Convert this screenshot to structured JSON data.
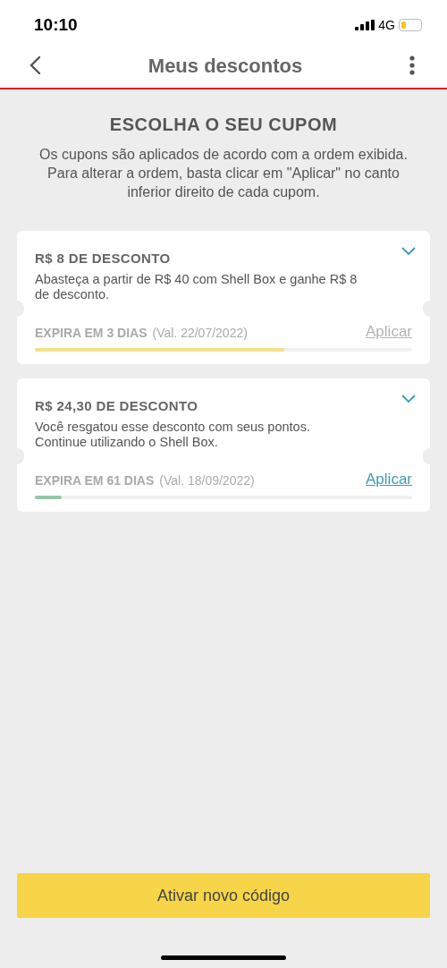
{
  "status_bar": {
    "time": "10:10",
    "network": "4G"
  },
  "header": {
    "title": "Meus descontos"
  },
  "intro": {
    "heading": "ESCOLHA O SEU CUPOM",
    "text": "Os cupons são aplicados de acordo com a ordem exibida. Para alterar a ordem, basta clicar em \"Aplicar\" no canto inferior direito de cada cupom."
  },
  "coupons": [
    {
      "title": "R$ 8 DE DESCONTO",
      "description": "Abasteça a partir de R$ 40 com Shell Box e ganhe R$ 8 de desconto.",
      "expiry": "EXPIRA EM 3 DIAS",
      "validity": "(Val. 22/07/2022)",
      "action": "Aplicar",
      "disabled": true,
      "level": 0.66,
      "color": "#f3e08a"
    },
    {
      "title": "R$ 24,30 DE DESCONTO",
      "description": "Você resgatou esse desconto com seus pontos. Continue utilizando o Shell Box.",
      "expiry": "EXPIRA EM 61 DIAS",
      "validity": "(Val. 18/09/2022)",
      "action": "Aplicar",
      "disabled": false,
      "level": 0.07,
      "color": "#93c9a7"
    }
  ],
  "primary_button": "Ativar novo código"
}
